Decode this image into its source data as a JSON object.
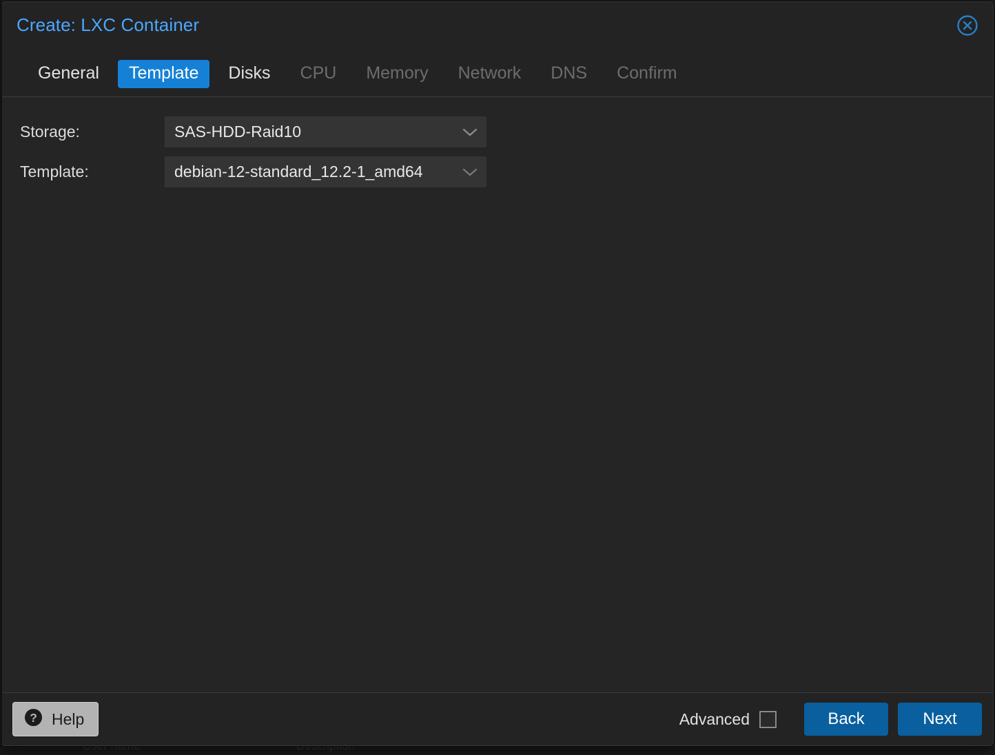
{
  "dialog": {
    "title": "Create: LXC Container",
    "close_icon": "close-circle-icon"
  },
  "tabs": [
    {
      "label": "General",
      "state": "enabled"
    },
    {
      "label": "Template",
      "state": "active"
    },
    {
      "label": "Disks",
      "state": "enabled"
    },
    {
      "label": "CPU",
      "state": "disabled"
    },
    {
      "label": "Memory",
      "state": "disabled"
    },
    {
      "label": "Network",
      "state": "disabled"
    },
    {
      "label": "DNS",
      "state": "disabled"
    },
    {
      "label": "Confirm",
      "state": "disabled"
    }
  ],
  "form": {
    "storage": {
      "label": "Storage:",
      "value": "SAS-HDD-Raid10",
      "arrow_icon": "chevron-down-icon"
    },
    "template": {
      "label": "Template:",
      "value": "debian-12-standard_12.2-1_amd64",
      "arrow_icon": "chevron-down-icon"
    }
  },
  "footer": {
    "help_label": "Help",
    "help_icon": "question-circle-icon",
    "advanced_label": "Advanced",
    "advanced_checked": false,
    "back_label": "Back",
    "next_label": "Next"
  },
  "background": {
    "col1": "User name",
    "col2": "Description"
  },
  "colors": {
    "accent_blue": "#1581d6",
    "title_blue": "#4da6ff",
    "button_blue": "#0a5f9e",
    "dialog_bg": "#232323",
    "body_bg": "#252525",
    "field_bg": "#343434",
    "help_bg": "#b3b3b3"
  }
}
